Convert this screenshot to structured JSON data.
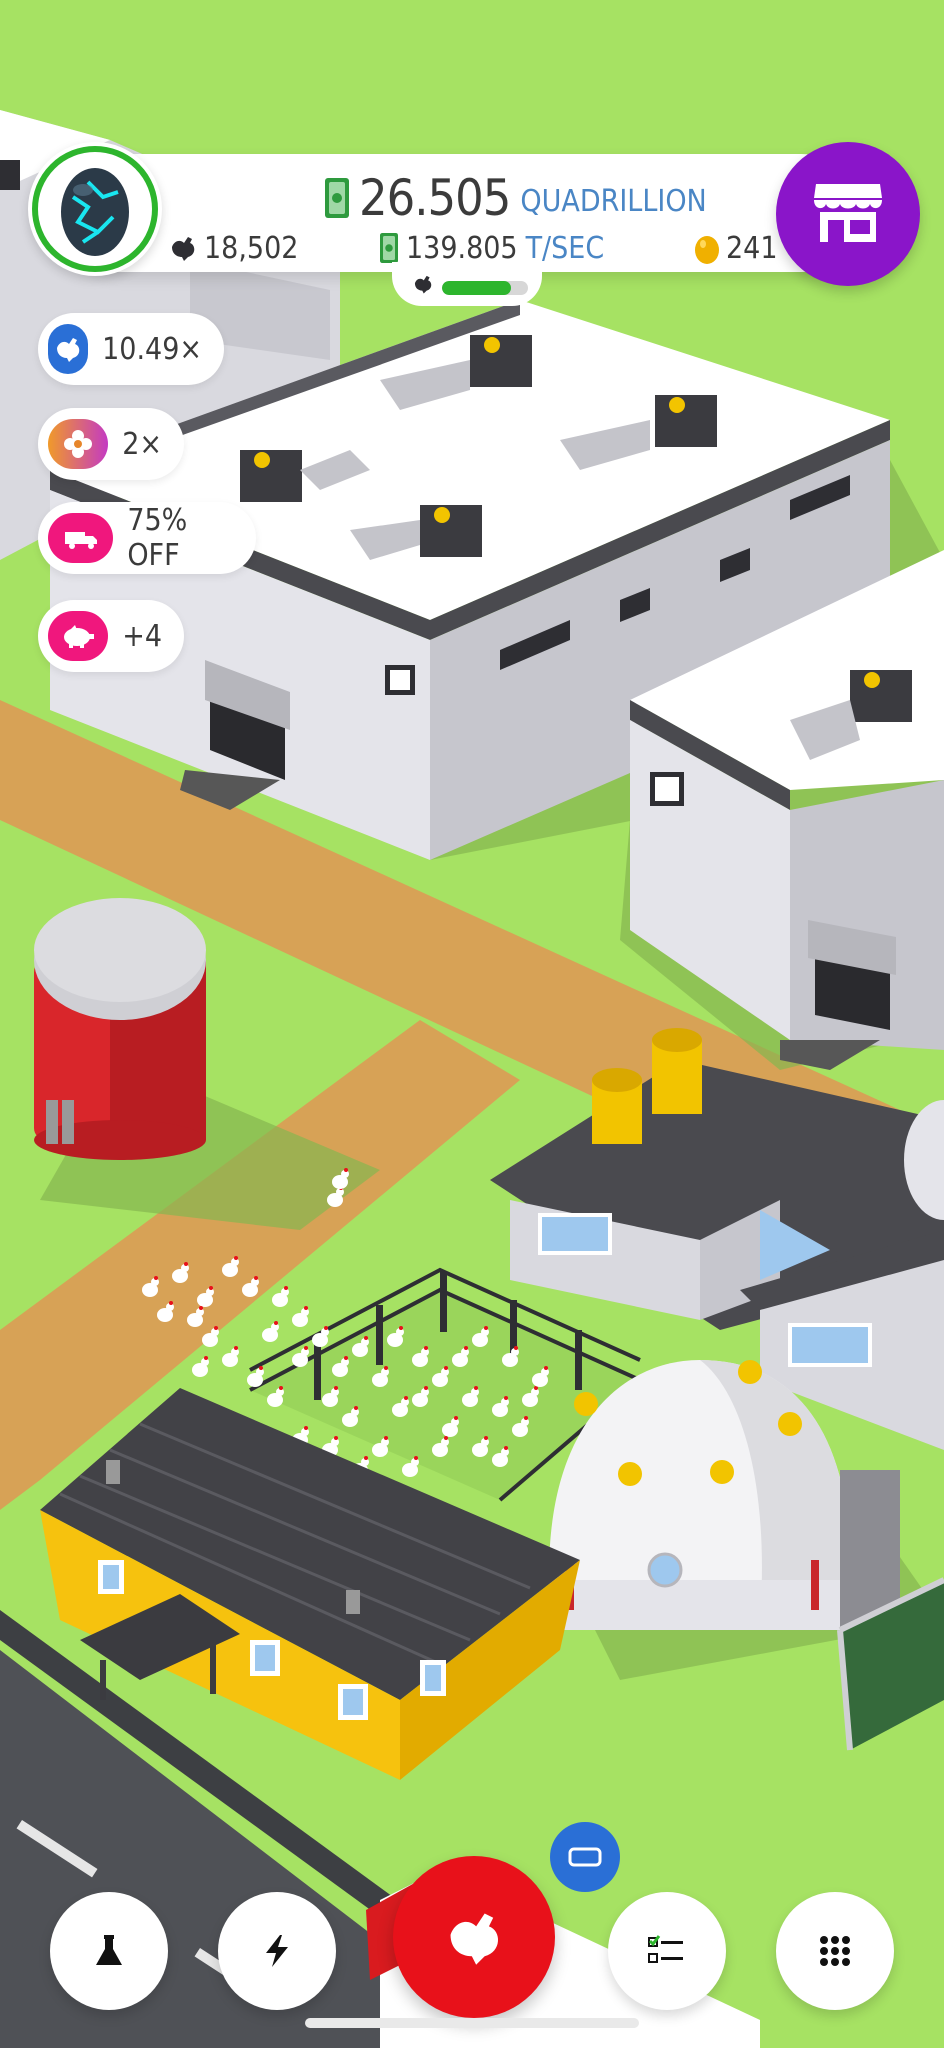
{
  "hud": {
    "money_value": "26.505",
    "money_unit": "QUADRILLION",
    "rate_value": "139.805",
    "rate_unit": "T/SEC",
    "chicken_count": "18,502",
    "golden_eggs": "241",
    "hatch_progress": 0.8
  },
  "boosts": [
    {
      "icon": "chicken-icon",
      "label": "10.49×",
      "color": "#2a6fd6"
    },
    {
      "icon": "flower-icon",
      "label": "2×",
      "color": "#e7862a"
    },
    {
      "icon": "truck-icon",
      "label": "75% OFF",
      "color": "#f0177d"
    },
    {
      "icon": "piggy-bank-icon",
      "label": "+4",
      "color": "#f0177d"
    }
  ],
  "nav": {
    "items": [
      "research-flask-icon",
      "lightning-icon",
      "chicken-icon",
      "checklist-icon",
      "grid-menu-icon"
    ]
  },
  "colors": {
    "grass": "#a6e263",
    "shop_purple": "#8a15c9",
    "main_red": "#e8111a",
    "accent_blue": "#4a86c5",
    "progress_green": "#2db52d"
  }
}
